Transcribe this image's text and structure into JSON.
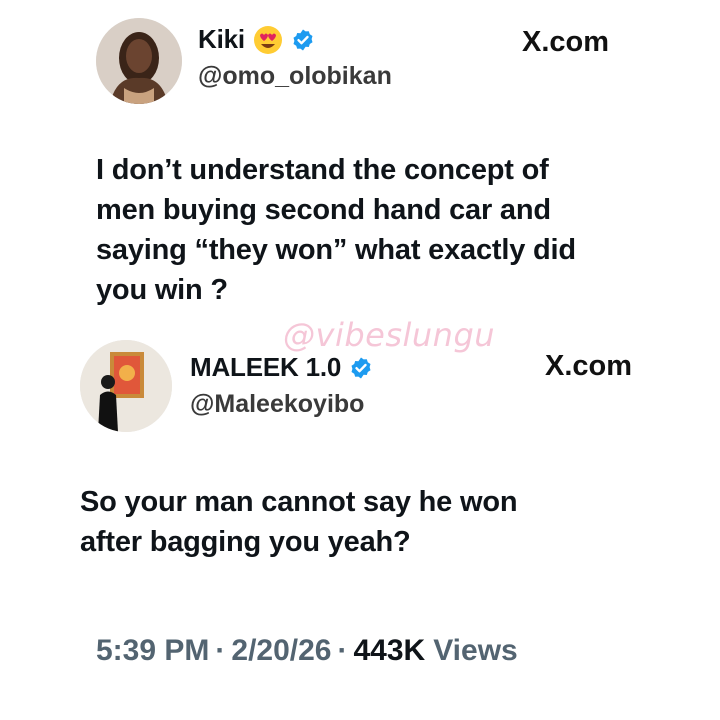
{
  "tweet1": {
    "name": "Kiki",
    "handle": "@omo_olobikan",
    "site": "X.com",
    "text_lines": [
      "I don’t understand the concept of",
      "men buying second hand car and",
      "saying “they won” what exactly did",
      "you win ?"
    ]
  },
  "tweet2": {
    "name": "MALEEK 1.0",
    "handle": "@Maleekoyibo",
    "site": "X.com",
    "text_lines": [
      "So your man cannot say he won",
      "after bagging you yeah?"
    ]
  },
  "watermark": "@vibeslungu",
  "meta": {
    "time": "5:39 PM",
    "date": "2/20/26",
    "views_count": "443K",
    "views_label": "Views",
    "separator": "·"
  },
  "colors": {
    "verified": "#1d9bf0",
    "text": "#0f1419",
    "muted": "#536471"
  }
}
